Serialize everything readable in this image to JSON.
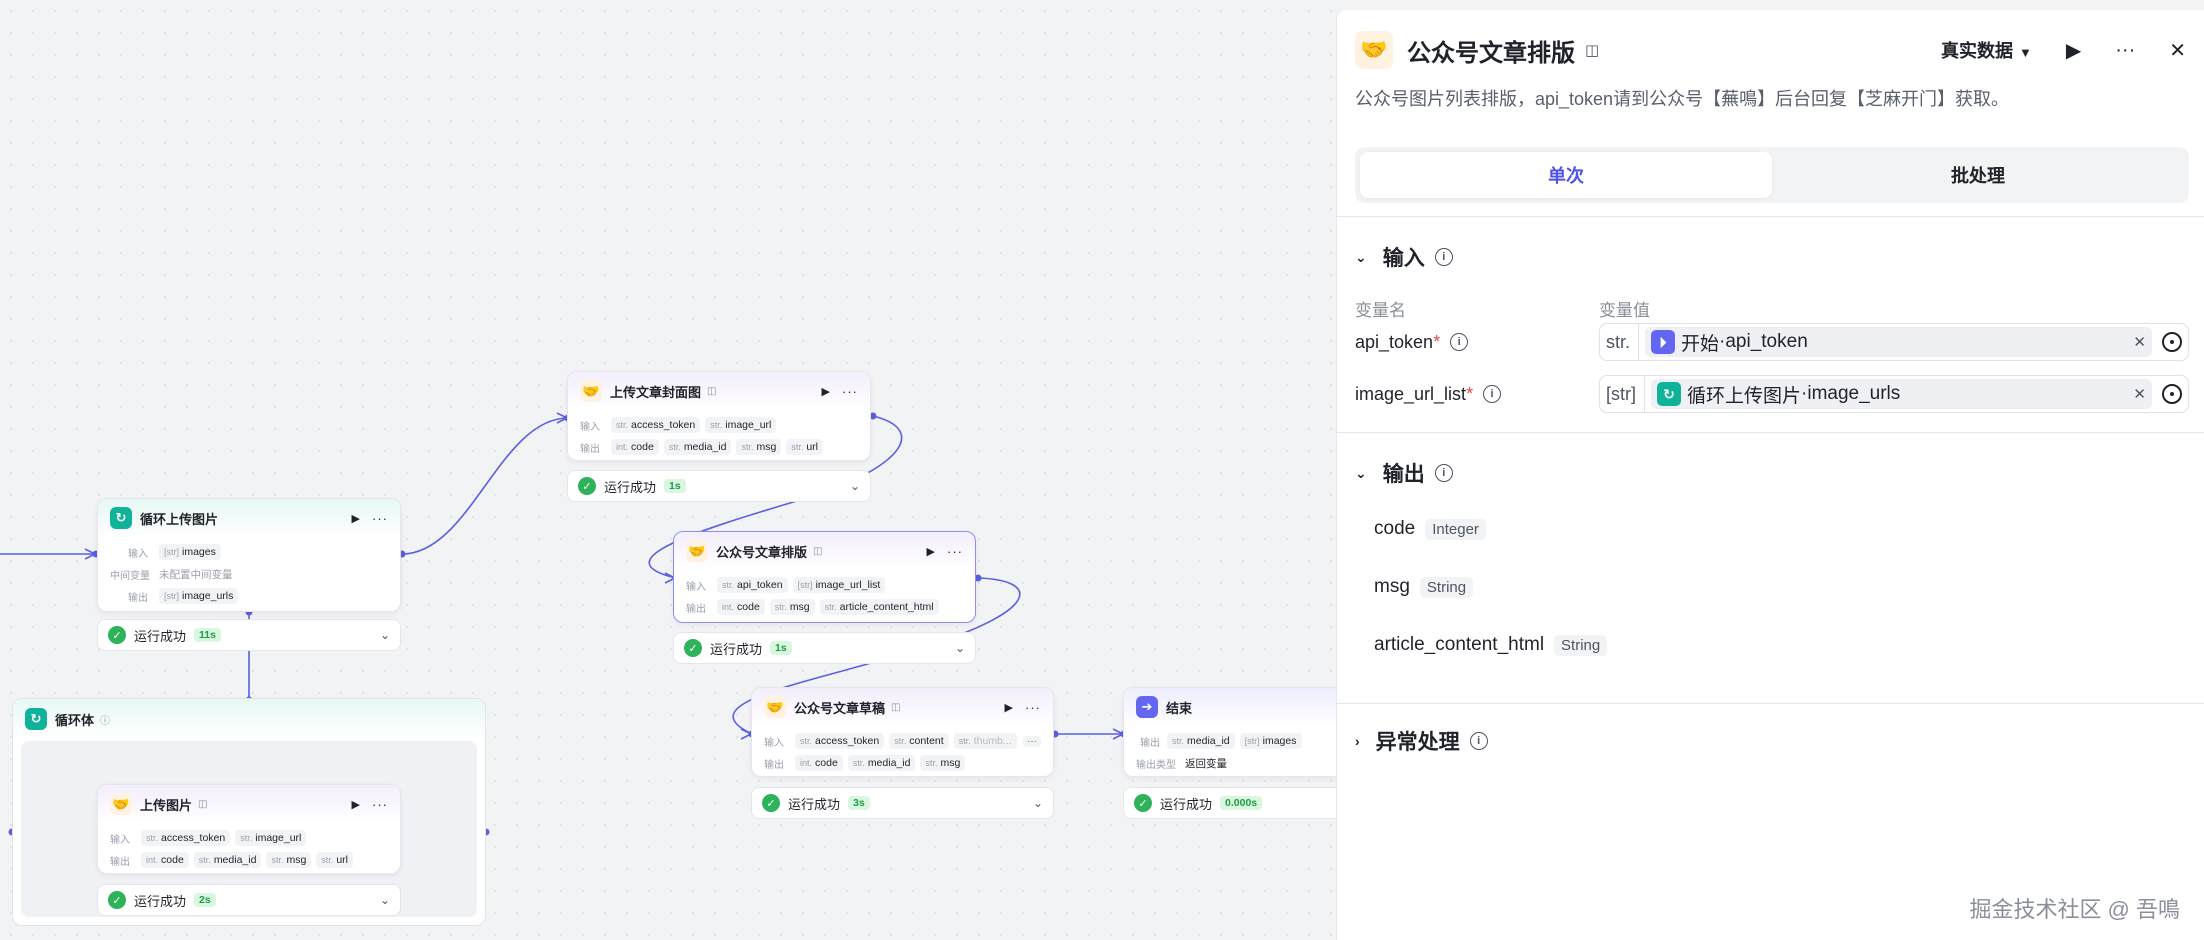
{
  "nodes": {
    "loop_upload": {
      "title": "循环上传图片",
      "input_label": "输入",
      "input_var": "images",
      "input_type": "[str]",
      "mid_label": "中间变量",
      "mid_value": "未配置中间变量",
      "output_label": "输出",
      "output_var": "image_urls",
      "output_type": "[str]",
      "status": "运行成功",
      "time": "11s"
    },
    "upload_cover": {
      "title": "上传文章封面图",
      "input_label": "输入",
      "inputs": [
        {
          "t": "str.",
          "v": "access_token"
        },
        {
          "t": "str.",
          "v": "image_url"
        }
      ],
      "output_label": "输出",
      "outputs": [
        {
          "t": "int.",
          "v": "code"
        },
        {
          "t": "str.",
          "v": "media_id"
        },
        {
          "t": "str.",
          "v": "msg"
        },
        {
          "t": "str.",
          "v": "url"
        }
      ],
      "status": "运行成功",
      "time": "1s"
    },
    "layout": {
      "title": "公众号文章排版",
      "input_label": "输入",
      "inputs": [
        {
          "t": "str.",
          "v": "api_token"
        },
        {
          "t": "[str]",
          "v": "image_url_list"
        }
      ],
      "output_label": "输出",
      "outputs": [
        {
          "t": "int.",
          "v": "code"
        },
        {
          "t": "str.",
          "v": "msg"
        },
        {
          "t": "str.",
          "v": "article_content_html"
        }
      ],
      "status": "运行成功",
      "time": "1s"
    },
    "draft": {
      "title": "公众号文章草稿",
      "input_label": "输入",
      "inputs": [
        {
          "t": "str.",
          "v": "access_token"
        },
        {
          "t": "str.",
          "v": "content"
        },
        {
          "t": "str.",
          "v": "thumb..."
        }
      ],
      "output_label": "输出",
      "outputs": [
        {
          "t": "int.",
          "v": "code"
        },
        {
          "t": "str.",
          "v": "media_id"
        },
        {
          "t": "str.",
          "v": "msg"
        }
      ],
      "status": "运行成功",
      "time": "3s"
    },
    "end": {
      "title": "结束",
      "output_label": "输出",
      "outputs": [
        {
          "t": "str.",
          "v": "media_id"
        },
        {
          "t": "[str]",
          "v": "images"
        }
      ],
      "type_label": "输出类型",
      "type_value": "返回变量",
      "status": "运行成功",
      "time": "0.000s"
    },
    "loop_body": {
      "title": "循环体"
    },
    "upload_image": {
      "title": "上传图片",
      "input_label": "输入",
      "inputs": [
        {
          "t": "str.",
          "v": "access_token"
        },
        {
          "t": "str.",
          "v": "image_url"
        }
      ],
      "output_label": "输出",
      "outputs": [
        {
          "t": "int.",
          "v": "code"
        },
        {
          "t": "str.",
          "v": "media_id"
        },
        {
          "t": "str.",
          "v": "msg"
        },
        {
          "t": "str.",
          "v": "url"
        }
      ],
      "status": "运行成功",
      "time": "2s"
    }
  },
  "panel": {
    "title": "公众号文章排版",
    "data_mode": "真实数据",
    "description": "公众号图片列表排版，api_token请到公众号【蕪鳴】后台回复【芝麻开门】获取。",
    "tabs": [
      "单次",
      "批处理"
    ],
    "input_section": "输入",
    "col_name": "变量名",
    "col_value": "变量值",
    "inputs": [
      {
        "name": "api_token",
        "req": "*",
        "type": "str.",
        "source": "开始",
        "sep": " · ",
        "var": "api_token"
      },
      {
        "name": "image_url_list",
        "req": "*",
        "type": "[str]",
        "source": "循环上传图片",
        "sep": " · ",
        "var": "image_urls"
      }
    ],
    "output_section": "输出",
    "outputs": [
      {
        "name": "code",
        "type": "Integer"
      },
      {
        "name": "msg",
        "type": "String"
      },
      {
        "name": "article_content_html",
        "type": "String"
      }
    ],
    "exception_section": "异常处理"
  },
  "watermark": "掘金技术社区 @ 吾鳴",
  "colors": {
    "accent": "#4d53e8",
    "success": "#2fb35a",
    "wire": "#5b5fe0",
    "loop": "#0fb39a"
  }
}
